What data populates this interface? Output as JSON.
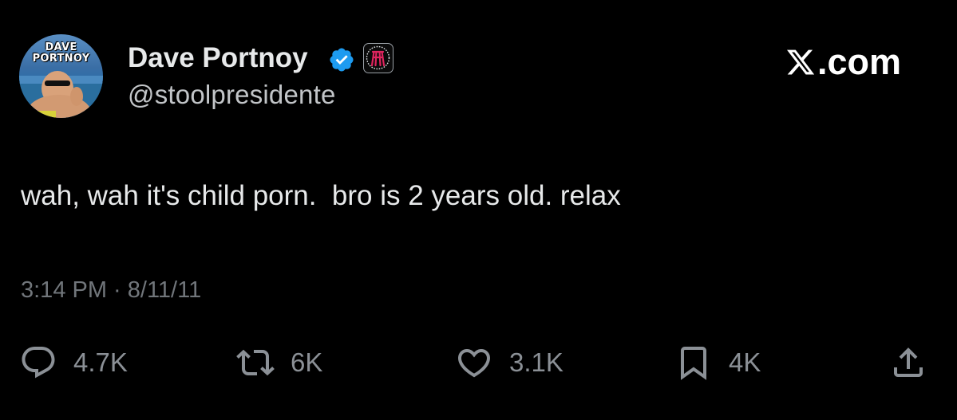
{
  "author": {
    "avatar_text_line1": "DAVE",
    "avatar_text_line2": "PORTNOY",
    "display_name": "Dave Portnoy",
    "handle": "@stoolpresidente",
    "verified": true
  },
  "brand": {
    "logo_text": ".com"
  },
  "tweet": {
    "text": "wah, wah it's child porn.  bro is 2 years old. relax",
    "timestamp": "3:14 PM · 8/11/11"
  },
  "actions": {
    "replies": "4.7K",
    "reposts": "6K",
    "likes": "3.1K",
    "bookmarks": "4K"
  },
  "colors": {
    "background": "#000000",
    "primary_text": "#e7e9ea",
    "secondary_text": "#71767b",
    "verified_blue": "#1d9bf0",
    "affiliate_red": "#e0245e"
  },
  "icons": {
    "verified": "verified-badge-icon",
    "affiliate": "barstool-affiliate-icon",
    "reply": "reply-icon",
    "repost": "repost-icon",
    "like": "heart-icon",
    "bookmark": "bookmark-icon",
    "share": "share-icon"
  }
}
